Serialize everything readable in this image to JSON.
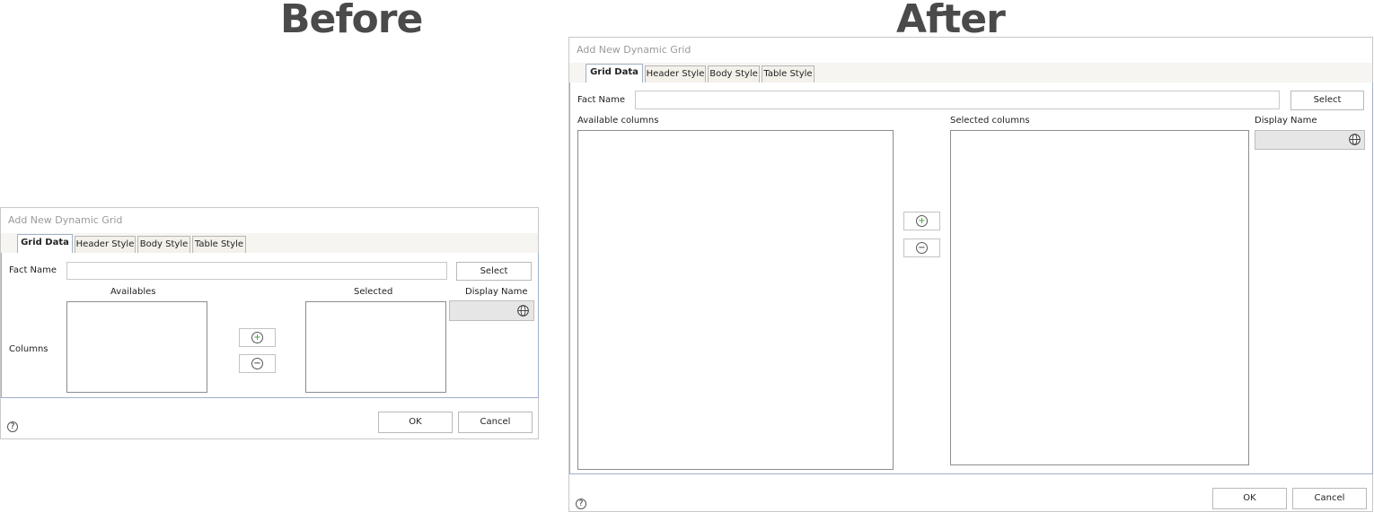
{
  "headings": {
    "before": "Before",
    "after": "After"
  },
  "before": {
    "window_title": "Add New Dynamic Grid",
    "tabs": [
      "Grid Data",
      "Header Style",
      "Body Style",
      "Table Style"
    ],
    "fact_name_label": "Fact Name",
    "fact_name_value": "",
    "select_label": "Select",
    "availables_label": "Availables",
    "selected_label": "Selected",
    "display_name_label": "Display Name",
    "columns_label": "Columns",
    "ok_label": "OK",
    "cancel_label": "Cancel",
    "help_glyph": "?"
  },
  "after": {
    "window_title": "Add New Dynamic Grid",
    "tabs": [
      "Grid Data",
      "Header Style",
      "Body Style",
      "Table Style"
    ],
    "fact_name_label": "Fact Name",
    "fact_name_value": "",
    "select_label": "Select",
    "available_columns_label": "Available columns",
    "selected_columns_label": "Selected columns",
    "display_name_label": "Display Name",
    "ok_label": "OK",
    "cancel_label": "Cancel",
    "help_glyph": "?"
  },
  "icons": {
    "add": "plus-circle-icon",
    "remove": "minus-circle-icon",
    "globe": "globe-icon",
    "help": "help-icon"
  },
  "colors": {
    "tab_border": "#9fb0c7",
    "heading": "#4a4a4a",
    "add_icon": "#3a9a3a"
  }
}
